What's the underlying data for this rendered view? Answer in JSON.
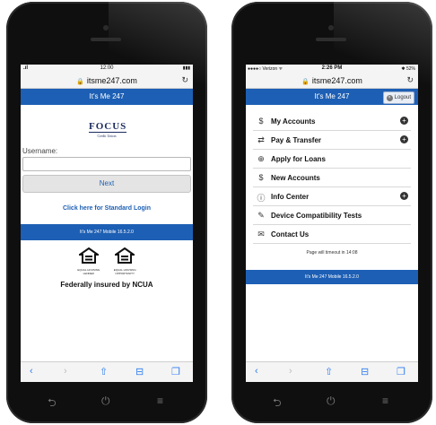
{
  "left_phone": {
    "status": {
      "signal": ".ıl",
      "time": "12:00",
      "battery": "▮▮▮"
    },
    "url": "itsme247.com",
    "banner_title": "It's Me 247",
    "logo_word": "FOCUS",
    "logo_sub": "Credit Union",
    "username_label": "Username:",
    "username_value": "",
    "next_label": "Next",
    "standard_login_link": "Click here for Standard Login",
    "version": "It's Me 247 Mobile 16.5.2.0",
    "eho_lender": "EQUAL HOUSING LENDER",
    "eho_opportunity": "EQUAL HOUSING OPPORTUNITY",
    "federally_insured": "Federally insured by NCUA"
  },
  "right_phone": {
    "status": {
      "carrier": "●●●●○ Verizon ᯤ",
      "time": "2:26 PM",
      "battery": "✱ 52%"
    },
    "url": "itsme247.com",
    "banner_title": "It's Me 247",
    "logout_label": "Logout",
    "menu": [
      {
        "label": "My Accounts",
        "icon": "dollar-icon",
        "glyph": "$",
        "expandable": true
      },
      {
        "label": "Pay & Transfer",
        "icon": "transfer-icon",
        "glyph": "⇄",
        "expandable": true
      },
      {
        "label": "Apply for Loans",
        "icon": "loan-icon",
        "glyph": "⊕",
        "expandable": false
      },
      {
        "label": "New Accounts",
        "icon": "new-account-icon",
        "glyph": "$",
        "expandable": false
      },
      {
        "label": "Info Center",
        "icon": "info-icon",
        "glyph": "ⓘ",
        "expandable": true
      },
      {
        "label": "Device Compatibility Tests",
        "icon": "wrench-icon",
        "glyph": "✎",
        "expandable": false
      },
      {
        "label": "Contact Us",
        "icon": "contact-icon",
        "glyph": "✉",
        "expandable": false
      }
    ],
    "timeout_text": "Page will timeout in 14:08",
    "version": "It's Me 247 Mobile 16.5.2.0"
  },
  "browser_toolbar": {
    "back": "‹",
    "forward": "›",
    "share": "⇧",
    "bookmarks": "⊟",
    "tabs": "❐"
  },
  "android_keys": {
    "back": "⮌",
    "home": "⏻",
    "menu": "≡"
  },
  "colors": {
    "brand_blue": "#1d5fb4",
    "link_blue": "#1d5fb4",
    "phone_body": "#0f0f0f"
  }
}
